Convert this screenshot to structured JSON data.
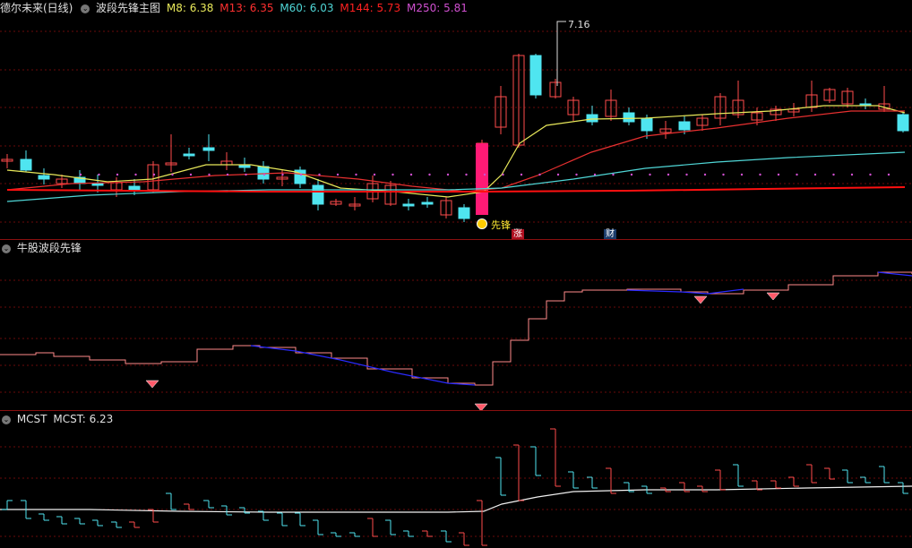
{
  "main": {
    "stock_name": "德尔未来(日线)",
    "indicator_name": "波段先锋主图",
    "ma": [
      {
        "label": "M8: 6.38",
        "color": "#e8e85a"
      },
      {
        "label": "M13: 6.35",
        "color": "#ff3030"
      },
      {
        "label": "M60: 6.03",
        "color": "#4fd6d6"
      },
      {
        "label": "M144: 5.73",
        "color": "#ff2020"
      },
      {
        "label": "M250: 5.81",
        "color": "#d050d0"
      }
    ],
    "high_price_label": "7.16",
    "signal_label": "先锋",
    "badge_zhang": "涨",
    "badge_cai": "财"
  },
  "sub1": {
    "title": "牛股波段先锋"
  },
  "sub2": {
    "title": "MCST",
    "value_label": "MCST: 6.23"
  },
  "colors": {
    "up": "#ff4b4b",
    "down": "#4fe5f0",
    "bg": "#000000",
    "grid": "#8a1010",
    "pink": "#ff1a75"
  }
}
